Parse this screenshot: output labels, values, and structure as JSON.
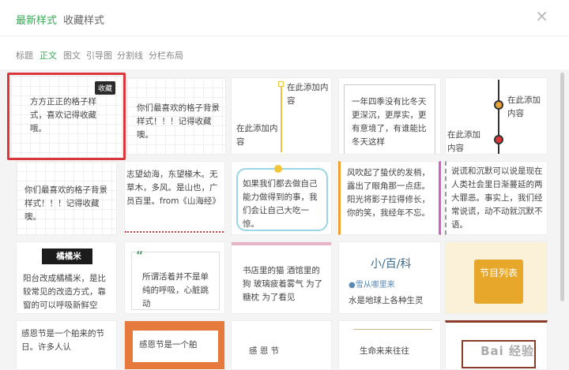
{
  "header": {
    "tabs": [
      {
        "label": "最新样式",
        "active": true
      },
      {
        "label": "收藏样式",
        "active": false
      }
    ],
    "close_icon": "close-icon"
  },
  "subtabs": [
    {
      "label": "标题"
    },
    {
      "label": "正文",
      "active": true
    },
    {
      "label": "图文"
    },
    {
      "label": "引导图"
    },
    {
      "label": "分割线"
    },
    {
      "label": "分栏布局"
    }
  ],
  "cards": {
    "c1": {
      "badge": "收藏",
      "text": "方方正正的格子样式，喜欢记得收藏哦。"
    },
    "c2": {
      "text": "你们最喜欢的格子背景样式！！！记得收藏噢。"
    },
    "c3": {
      "top_text": "在此添加内容",
      "bottom_text": "在此添加内容"
    },
    "c4": {
      "text": "一年四季没有比冬天更深沉，更厚实，更有意境了，有谁能比冬天这样"
    },
    "c5": {
      "top_text": "在此添加内容",
      "bottom_text": "在此添加内容"
    },
    "c6": {
      "text": "你们最喜欢的格子背景样式！！！记得收藏噢。"
    },
    "c7": {
      "text": "志望幼海，东望椽木。无草木，多风。是山也，广员百里。from《山海经》"
    },
    "c8": {
      "text": "如果我们都去做自己能力做得到的事，我们会让自己大吃一惊。"
    },
    "c9": {
      "text": "风吹起了蛰伏的发梢，露出了眼角那一点痣。阳光将影子拉得修长，你的笑，我经年不忘。"
    },
    "c10": {
      "text": "说谎和沉默可以说是现在人类社会里日渐蔓延的两大罪恶。事实上，我们经常说谎，动不动就沉默不语。"
    },
    "c11": {
      "title": "橘橘米",
      "text": "阳台改成橘橘米，是比较常见的改造方式，靠窗的可以呼吸新鲜空气，是可以"
    },
    "c12": {
      "quote": "“",
      "text": "所谓活着并不是单纯的呼吸，心脏跳动"
    },
    "c13": {
      "text": "书店里的猫 酒馆里的狗 玻璃疲着雾气 为了糖枕 为了看见"
    },
    "c14": {
      "title": "小/百/科",
      "sub": "●雪从哪里来",
      "text": "水是地球上各种生灵"
    },
    "c15": {
      "text": "节目列表"
    },
    "c16": {
      "text": "感恩节是一个舶来的节日。许多人认"
    },
    "c17": {
      "text": "感恩节是一个舶"
    },
    "c18": {
      "text": "感 恩 节"
    },
    "c19": {
      "text": "生命来来往往"
    }
  },
  "watermark": "Bai 经验",
  "colors": {
    "accent": "#3aa757",
    "highlight": "#d9373b"
  }
}
